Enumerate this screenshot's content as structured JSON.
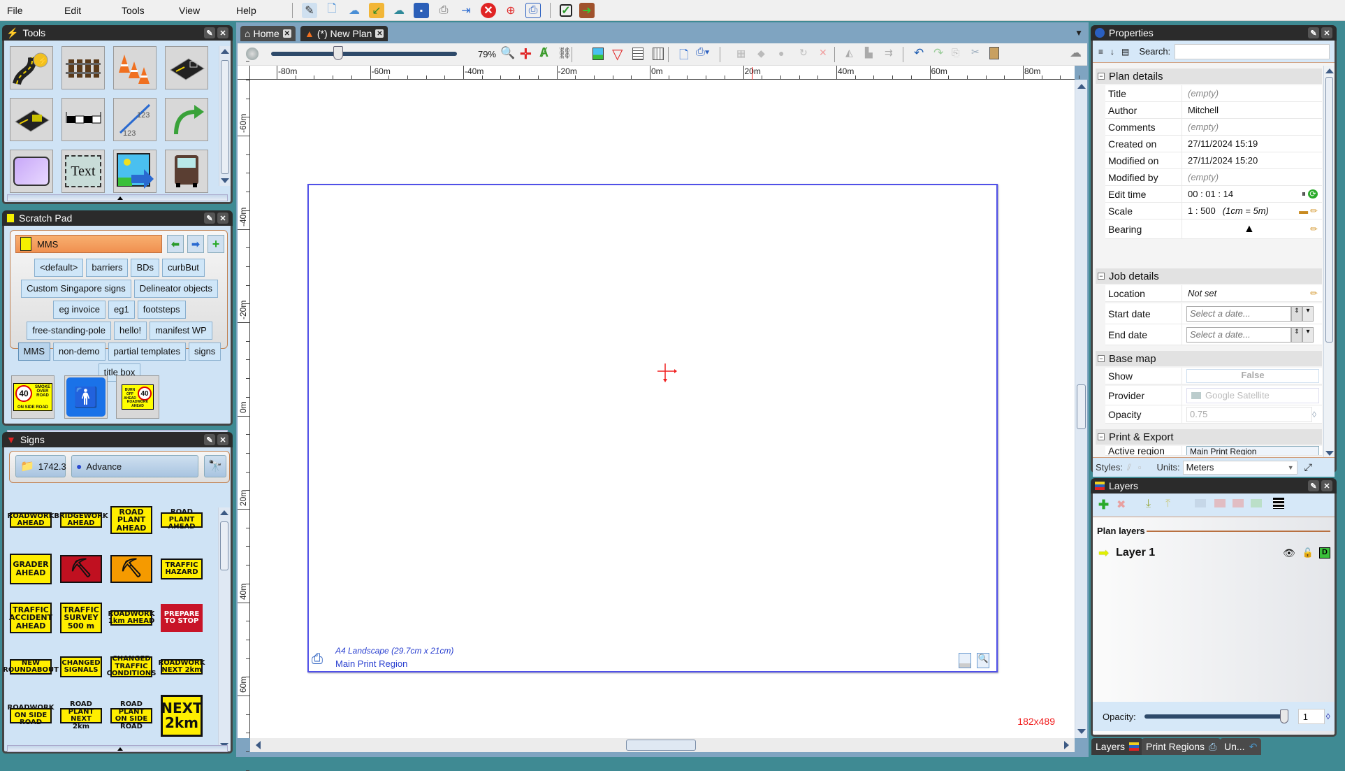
{
  "menu": {
    "items": [
      "File",
      "Edit",
      "Tools",
      "View",
      "Help"
    ]
  },
  "main_toolbar_icons": [
    "new-plan-wizard-icon",
    "new-document-icon",
    "new-cloud-document-icon",
    "open-folder-icon",
    "cloud-sync-icon",
    "save-icon",
    "print-icon",
    "export-icon",
    "close-red-icon",
    "target-icon",
    "print-region-icon",
    "checkbox-icon",
    "exit-door-icon"
  ],
  "tools_panel": {
    "title": "Tools",
    "tools": [
      "road-tool",
      "rail-track-tool",
      "traffic-cones-tool",
      "road-segment-tool",
      "road-marking-tool",
      "barrier-tool",
      "dimension-tool",
      "arrow-tool",
      "shape-tool",
      "text-tool",
      "image-tool",
      "vehicle-tool"
    ],
    "text_tool_label": "Text",
    "dimension_label": "123"
  },
  "scratch_pad": {
    "title": "Scratch Pad",
    "current": "MMS",
    "categories": [
      "<default>",
      "barriers",
      "BDs",
      "curbBut",
      "Custom Singapore signs",
      "Delineator objects",
      "eg invoice",
      "eg1",
      "footsteps",
      "free-standing-pole",
      "hello!",
      "manifest WP",
      "MMS",
      "non-demo",
      "partial templates",
      "signs",
      "title box"
    ],
    "selected_category": "MMS",
    "items": [
      {
        "name": "speed-40-smoke-over-road",
        "speed": "40",
        "text": "SMOKE OVER ROAD",
        "sub": "ON SIDE ROAD"
      },
      {
        "name": "pedestrian-sign"
      },
      {
        "name": "burn-off-ahead-40",
        "speed": "40",
        "text": "BURN OFF AHEAD",
        "sub": "ROADWORK AHEAD"
      }
    ]
  },
  "signs_panel": {
    "title": "Signs",
    "version": "1742.3",
    "category": "Advance",
    "signs": [
      {
        "text": "ROADWORK AHEAD",
        "style": "small"
      },
      {
        "text": "BRIDGEWORK AHEAD",
        "style": "small"
      },
      {
        "text": "ROAD PLANT AHEAD",
        "style": "large"
      },
      {
        "text": "ROAD PLANT AHEAD",
        "style": "small"
      },
      {
        "text": "GRADER AHEAD",
        "style": "medium"
      },
      {
        "text": "",
        "style": "worker-red"
      },
      {
        "text": "",
        "style": "worker-orange"
      },
      {
        "text": "TRAFFIC HAZARD",
        "style": "medium-wide"
      },
      {
        "text": "TRAFFIC ACCIDENT AHEAD",
        "style": "medium"
      },
      {
        "text": "TRAFFIC SURVEY 500 m",
        "style": "medium"
      },
      {
        "text": "ROADWORK 1km AHEAD",
        "style": "small"
      },
      {
        "text": "PREPARE TO STOP",
        "style": "red"
      },
      {
        "text": "NEW ROUNDABOUT",
        "style": "small"
      },
      {
        "text": "CHANGED SIGNALS",
        "style": "medium-wide"
      },
      {
        "text": "CHANGED TRAFFIC CONDITIONS",
        "style": "medium-wide"
      },
      {
        "text": "ROADWORK NEXT 2km",
        "style": "small"
      },
      {
        "text": "ROADWORK ON SIDE ROAD",
        "style": "small"
      },
      {
        "text": "ROAD PLANT NEXT 2km",
        "style": "small"
      },
      {
        "text": "ROAD PLANT ON SIDE ROAD",
        "style": "small"
      },
      {
        "text": "NEXT 2km",
        "style": "big"
      }
    ]
  },
  "tabs": [
    {
      "label": "Home",
      "icon": "home-icon"
    },
    {
      "label": "(*) New Plan",
      "icon": "traffic-cone-icon"
    }
  ],
  "plan_toolbar": {
    "zoom_percent": "79%",
    "zoom_slider_fraction": 0.36
  },
  "rulers": {
    "horizontal": [
      "-80m",
      "-60m",
      "-40m",
      "-20m",
      "0m",
      "20m",
      "40m",
      "60m",
      "80m"
    ],
    "vertical": [
      "-60m",
      "-40m",
      "-20m",
      "0m",
      "20m",
      "40m",
      "60m"
    ]
  },
  "print_region": {
    "paper": "A4 Landscape (29.7cm x 21cm)",
    "name": "Main Print Region"
  },
  "canvas_status": "182x489",
  "properties": {
    "title": "Properties",
    "search_label": "Search:",
    "search_value": "",
    "sections": {
      "plan_details": {
        "title": "Plan details",
        "rows": [
          {
            "label": "Title",
            "value": "(empty)",
            "empty": true
          },
          {
            "label": "Author",
            "value": "Mitchell"
          },
          {
            "label": "Comments",
            "value": "(empty)",
            "empty": true
          },
          {
            "label": "Created on",
            "value": "27/11/2024 15:19"
          },
          {
            "label": "Modified on",
            "value": "27/11/2024 15:20"
          },
          {
            "label": "Modified by",
            "value": "(empty)",
            "empty": true
          },
          {
            "label": "Edit time",
            "value": "00 : 01 : 14"
          },
          {
            "label": "Scale",
            "value": "1 : 500",
            "note": "(1cm = 5m)"
          },
          {
            "label": "Bearing",
            "value": ""
          }
        ]
      },
      "job_details": {
        "title": "Job details",
        "location_label": "Location",
        "location_value": "Not set",
        "start_label": "Start date",
        "start_placeholder": "Select a date...",
        "end_label": "End date",
        "end_placeholder": "Select a date..."
      },
      "base_map": {
        "title": "Base map",
        "show_label": "Show",
        "show_value": "False",
        "provider_label": "Provider",
        "provider_value": "Google Satellite",
        "opacity_label": "Opacity",
        "opacity_value": "0.75"
      },
      "print_export": {
        "title": "Print & Export",
        "active_region_label": "Active region",
        "active_region_value": "Main Print Region"
      }
    },
    "styles_label": "Styles:",
    "units_label": "Units:",
    "units_value": "Meters"
  },
  "layers": {
    "title": "Layers",
    "section": "Plan layers",
    "items": [
      {
        "name": "Layer 1",
        "visible": true,
        "locked": false
      }
    ],
    "opacity_label": "Opacity:",
    "opacity_value": "1",
    "opacity_fraction": 1.0
  },
  "bottom_tabs": [
    "Layers",
    "Print Regions",
    "Un..."
  ],
  "colors": {
    "accent_orange": "#f0a060",
    "print_region_border": "#4a4ae8",
    "status_red": "#ff2020",
    "panel_dark": "#2b2b2b",
    "panel_bg": "#cfe3f5"
  }
}
